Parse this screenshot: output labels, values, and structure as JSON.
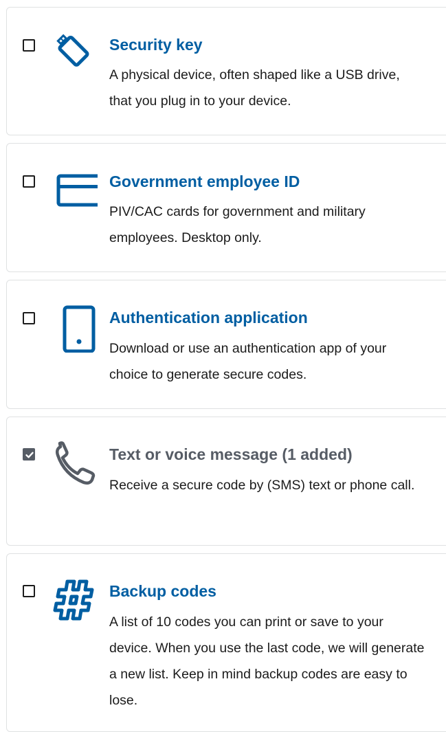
{
  "colors": {
    "accent": "#005ea2",
    "disabled": "#565c65",
    "text": "#1b1b1b",
    "border": "#dfe1e2"
  },
  "options": [
    {
      "icon": "security-key-icon",
      "title": "Security key",
      "description": "A physical device, often shaped like a USB drive, that you plug in to your device.",
      "checked": false
    },
    {
      "icon": "id-card-icon",
      "title": "Government employee ID",
      "description": "PIV/CAC cards for government and military employees. Desktop only.",
      "checked": false
    },
    {
      "icon": "mobile-device-icon",
      "title": "Authentication application",
      "description": "Download or use an authentication app of your choice to generate secure codes.",
      "checked": false
    },
    {
      "icon": "phone-icon",
      "title": "Text or voice message (1 added)",
      "description": "Receive a secure code by (SMS) text or phone call.",
      "checked": true
    },
    {
      "icon": "hashtag-icon",
      "title": "Backup codes",
      "description": "A list of 10 codes you can print or save to your device. When you use the last code, we will generate a new list. Keep in mind backup codes are easy to lose.",
      "checked": false
    }
  ]
}
